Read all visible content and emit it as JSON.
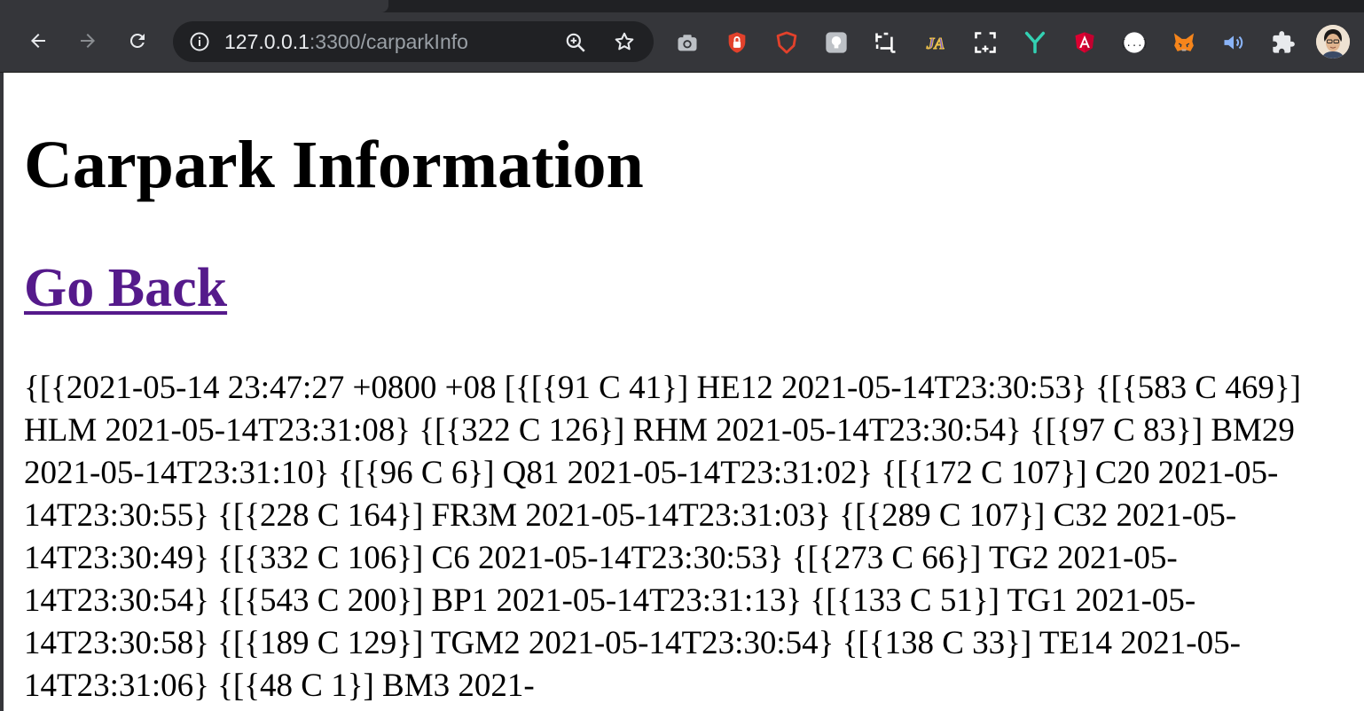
{
  "browser": {
    "url_host": "127.0.0.1",
    "url_rest": ":3300/carparkInfo",
    "extensions": [
      "camera-icon",
      "lock-shield-icon",
      "brave-shield-icon",
      "lightbulb-icon",
      "crop-icon",
      "ja-icon",
      "screenshot-icon",
      "y-icon",
      "angular-icon",
      "json-icon",
      "metamask-fox-icon",
      "speaker-icon",
      "puzzle-icon"
    ]
  },
  "page": {
    "title": "Carpark Information",
    "back_link": "Go Back",
    "data_text": "{[{2021-05-14 23:47:27 +0800 +08 [{[{91 C 41}] HE12 2021-05-14T23:30:53} {[{583 C 469}] HLM 2021-05-14T23:31:08} {[{322 C 126}] RHM 2021-05-14T23:30:54} {[{97 C 83}] BM29 2021-05-14T23:31:10} {[{96 C 6}] Q81 2021-05-14T23:31:02} {[{172 C 107}] C20 2021-05-14T23:30:55} {[{228 C 164}] FR3M 2021-05-14T23:31:03} {[{289 C 107}] C32 2021-05-14T23:30:49} {[{332 C 106}] C6 2021-05-14T23:30:53} {[{273 C 66}] TG2 2021-05-14T23:30:54} {[{543 C 200}] BP1 2021-05-14T23:31:13} {[{133 C 51}] TG1 2021-05-14T23:30:58} {[{189 C 129}] TGM2 2021-05-14T23:30:54} {[{138 C 33}] TE14 2021-05-14T23:31:06} {[{48 C 1}] BM3 2021-"
  }
}
